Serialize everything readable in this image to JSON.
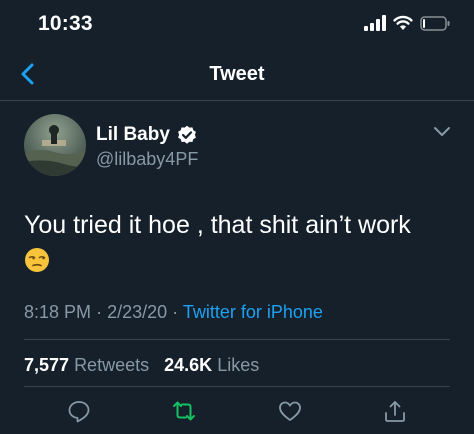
{
  "status_bar": {
    "time": "10:33"
  },
  "nav": {
    "title": "Tweet"
  },
  "tweet": {
    "author_name": "Lil Baby",
    "handle": "@lilbaby4PF",
    "verified": true,
    "text": "You tried it hoe , that shit ain’t work",
    "emoji": "unamused-face",
    "time": "8:18 PM",
    "sep1": "·",
    "date": "2/23/20",
    "sep2": "·",
    "source": "Twitter for iPhone"
  },
  "stats": {
    "retweets_count": "7,577",
    "retweets_label": "Retweets",
    "likes_count": "24.6K",
    "likes_label": "Likes"
  },
  "actions": [
    "reply-icon",
    "retweet-icon",
    "like-icon",
    "share-icon"
  ],
  "colors": {
    "background": "#15202b",
    "secondary_text": "#8899a6",
    "accent": "#1da1f2",
    "retweet": "#17bf63",
    "divider": "#38444d"
  }
}
